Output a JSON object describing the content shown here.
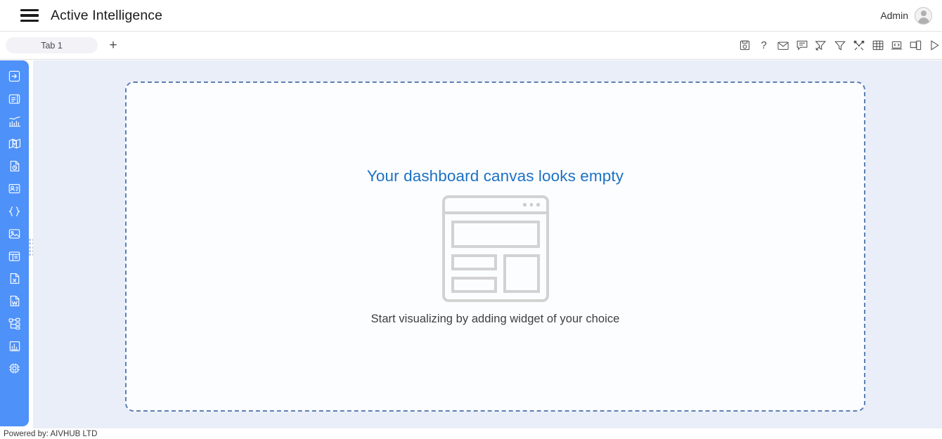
{
  "header": {
    "menu_icon": "hamburger-menu-icon",
    "title": "Active Intelligence",
    "user_name": "Admin",
    "avatar_icon": "user-avatar-icon"
  },
  "tab_bar": {
    "tabs": [
      {
        "label": "Tab 1",
        "active": true
      }
    ],
    "add_tab_label": "+",
    "toolbar": [
      {
        "name": "save-icon",
        "title": "Save"
      },
      {
        "name": "help-icon",
        "title": "Help",
        "glyph": "?"
      },
      {
        "name": "email-icon",
        "title": "Email"
      },
      {
        "name": "comment-icon",
        "title": "Comment"
      },
      {
        "name": "clear-filter-icon",
        "title": "Clear Filter"
      },
      {
        "name": "filter-icon",
        "title": "Filter"
      },
      {
        "name": "tools-icon",
        "title": "Tools"
      },
      {
        "name": "table-grid-icon",
        "title": "Table"
      },
      {
        "name": "embed-code-icon",
        "title": "Embed Code"
      },
      {
        "name": "duplicate-icon",
        "title": "Duplicate"
      },
      {
        "name": "play-icon",
        "title": "Run"
      }
    ]
  },
  "sidebar": {
    "items": [
      {
        "name": "sidebar-item-import",
        "icon": "arrow-into-box-icon"
      },
      {
        "name": "sidebar-item-dashboard-panel",
        "icon": "panel-layout-icon"
      },
      {
        "name": "sidebar-item-analytics",
        "icon": "bar-chart-trend-icon"
      },
      {
        "name": "sidebar-item-map",
        "icon": "map-location-icon"
      },
      {
        "name": "sidebar-item-report-refresh",
        "icon": "document-refresh-icon"
      },
      {
        "name": "sidebar-item-contact-card",
        "icon": "id-card-icon"
      },
      {
        "name": "sidebar-item-code",
        "icon": "curly-braces-icon"
      },
      {
        "name": "sidebar-item-image",
        "icon": "image-icon"
      },
      {
        "name": "sidebar-item-webpage",
        "icon": "web-page-icon"
      },
      {
        "name": "sidebar-item-excel",
        "icon": "excel-file-icon"
      },
      {
        "name": "sidebar-item-word",
        "icon": "word-file-icon"
      },
      {
        "name": "sidebar-item-hierarchy",
        "icon": "tree-hierarchy-icon"
      },
      {
        "name": "sidebar-item-chart",
        "icon": "bar-chart-icon"
      },
      {
        "name": "sidebar-item-processor",
        "icon": "cpu-chip-icon"
      }
    ],
    "resize_handle": "sidebar-resize-handle",
    "background_color": "#4e91f9"
  },
  "canvas": {
    "background_color": "#e9eef8",
    "dropzone_border_color": "#5d7fb5",
    "empty_state": {
      "title": "Your dashboard canvas looks empty",
      "title_color": "#1c71c4",
      "subtitle": "Start visualizing by adding widget of your choice",
      "illustration": "dashboard-wireframe-illustration"
    }
  },
  "footer": {
    "text": "Powered by: AIVHUB LTD"
  }
}
